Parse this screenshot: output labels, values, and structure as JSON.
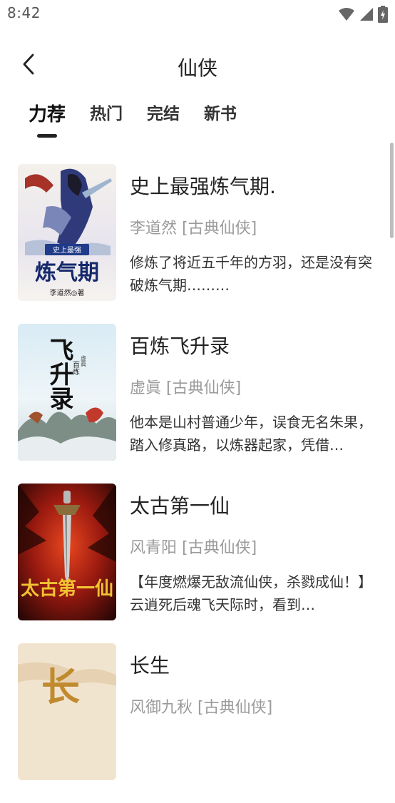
{
  "status_bar": {
    "time": "8:42"
  },
  "header": {
    "title": "仙侠",
    "back_icon": "chevron-left-icon"
  },
  "tabs": [
    {
      "label": "力荐",
      "active": true
    },
    {
      "label": "热门",
      "active": false
    },
    {
      "label": "完结",
      "active": false
    },
    {
      "label": "新书",
      "active": false
    }
  ],
  "books": [
    {
      "title": "史上最强炼气期.",
      "meta": "李道然 [古典仙侠]",
      "description": "修炼了将近五千年的方羽，还是没有突破炼气期………",
      "cover_text": "炼气期",
      "cover_subtext": "史上最强",
      "cover_author": "李道然◎著"
    },
    {
      "title": "百炼飞升录",
      "meta": "虚眞 [古典仙侠]",
      "description": "他本是山村普通少年，误食无名朱果，踏入修真路，以炼器起家，凭借…",
      "cover_text": "飞升录",
      "cover_subtext": "百炼",
      "cover_author": "虚眞"
    },
    {
      "title": "太古第一仙",
      "meta": "风青阳 [古典仙侠]",
      "description": "【年度燃爆无敌流仙侠，杀戮成仙！】云逍死后魂飞天际时，看到…",
      "cover_text": "太古第一仙",
      "cover_subtext": "",
      "cover_author": ""
    },
    {
      "title": "长生",
      "meta": "风御九秋 [古典仙侠]",
      "description": "",
      "cover_text": "长",
      "cover_subtext": "",
      "cover_author": ""
    }
  ],
  "colors": {
    "accent": "#222222",
    "meta": "#9a9a9a"
  }
}
